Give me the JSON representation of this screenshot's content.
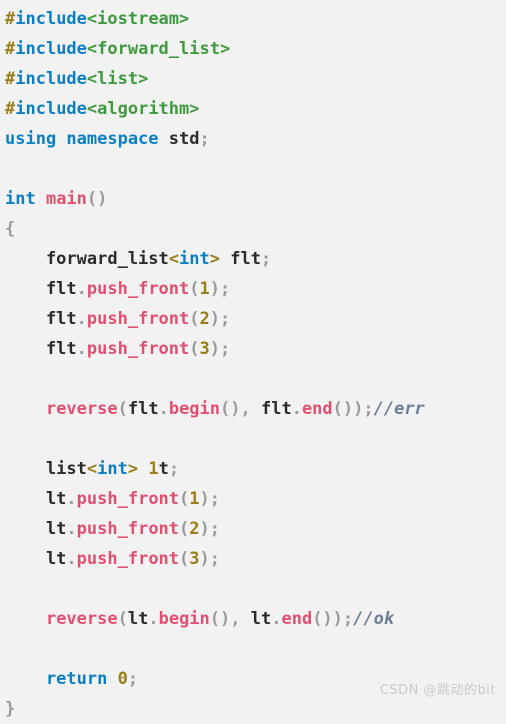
{
  "editor": {
    "language": "C++",
    "background_color": "#f2f2f2",
    "theme_colors": {
      "plain": "#2b2b2b",
      "keyword": "#0c7fc4",
      "preprocessor": "#9a7d16",
      "include_path": "#3f9a3f",
      "function": "#e05071",
      "number": "#9a7d16",
      "punctuation": "#9a9a9a",
      "comment": "#6b7f99",
      "watermark": "#c9c9c9"
    },
    "lines": [
      {
        "id": "line-1",
        "tokens": [
          {
            "t": "pre",
            "v": "#"
          },
          {
            "t": "kw",
            "v": "include"
          },
          {
            "t": "inc",
            "v": "<iostream>"
          }
        ]
      },
      {
        "id": "line-2",
        "tokens": [
          {
            "t": "pre",
            "v": "#"
          },
          {
            "t": "kw",
            "v": "include"
          },
          {
            "t": "inc",
            "v": "<forward_list>"
          }
        ]
      },
      {
        "id": "line-3",
        "tokens": [
          {
            "t": "pre",
            "v": "#"
          },
          {
            "t": "kw",
            "v": "include"
          },
          {
            "t": "inc",
            "v": "<list>"
          }
        ]
      },
      {
        "id": "line-4",
        "tokens": [
          {
            "t": "pre",
            "v": "#"
          },
          {
            "t": "kw",
            "v": "include"
          },
          {
            "t": "inc",
            "v": "<algorithm>"
          }
        ]
      },
      {
        "id": "line-5",
        "tokens": [
          {
            "t": "kw",
            "v": "using namespace "
          },
          {
            "t": "plain",
            "v": "std"
          },
          {
            "t": "punc",
            "v": ";"
          }
        ]
      },
      {
        "id": "line-6",
        "tokens": []
      },
      {
        "id": "line-7",
        "tokens": [
          {
            "t": "kw",
            "v": "int "
          },
          {
            "t": "fn",
            "v": "main"
          },
          {
            "t": "punc",
            "v": "()"
          }
        ]
      },
      {
        "id": "line-8",
        "tokens": [
          {
            "t": "punc",
            "v": "{"
          }
        ]
      },
      {
        "id": "line-9",
        "tokens": [
          {
            "t": "plain",
            "v": "    forward_list"
          },
          {
            "t": "angle",
            "v": "<"
          },
          {
            "t": "kw",
            "v": "int"
          },
          {
            "t": "angle",
            "v": "> "
          },
          {
            "t": "plain",
            "v": "flt"
          },
          {
            "t": "punc",
            "v": ";"
          }
        ]
      },
      {
        "id": "line-10",
        "tokens": [
          {
            "t": "plain",
            "v": "    flt"
          },
          {
            "t": "punc",
            "v": "."
          },
          {
            "t": "fn",
            "v": "push_front"
          },
          {
            "t": "punc",
            "v": "("
          },
          {
            "t": "num",
            "v": "1"
          },
          {
            "t": "punc",
            "v": ");"
          }
        ]
      },
      {
        "id": "line-11",
        "tokens": [
          {
            "t": "plain",
            "v": "    flt"
          },
          {
            "t": "punc",
            "v": "."
          },
          {
            "t": "fn",
            "v": "push_front"
          },
          {
            "t": "punc",
            "v": "("
          },
          {
            "t": "num",
            "v": "2"
          },
          {
            "t": "punc",
            "v": ");"
          }
        ]
      },
      {
        "id": "line-12",
        "tokens": [
          {
            "t": "plain",
            "v": "    flt"
          },
          {
            "t": "punc",
            "v": "."
          },
          {
            "t": "fn",
            "v": "push_front"
          },
          {
            "t": "punc",
            "v": "("
          },
          {
            "t": "num",
            "v": "3"
          },
          {
            "t": "punc",
            "v": ");"
          }
        ]
      },
      {
        "id": "line-13",
        "tokens": []
      },
      {
        "id": "line-14",
        "tokens": [
          {
            "t": "plain",
            "v": "    "
          },
          {
            "t": "fn",
            "v": "reverse"
          },
          {
            "t": "punc",
            "v": "("
          },
          {
            "t": "plain",
            "v": "flt"
          },
          {
            "t": "punc",
            "v": "."
          },
          {
            "t": "fn",
            "v": "begin"
          },
          {
            "t": "punc",
            "v": "(), "
          },
          {
            "t": "plain",
            "v": "flt"
          },
          {
            "t": "punc",
            "v": "."
          },
          {
            "t": "fn",
            "v": "end"
          },
          {
            "t": "punc",
            "v": "());"
          },
          {
            "t": "cmt",
            "v": "//err"
          }
        ]
      },
      {
        "id": "line-15",
        "tokens": []
      },
      {
        "id": "line-16",
        "tokens": [
          {
            "t": "plain",
            "v": "    list"
          },
          {
            "t": "angle",
            "v": "<"
          },
          {
            "t": "kw",
            "v": "int"
          },
          {
            "t": "angle",
            "v": "> "
          },
          {
            "t": "num",
            "v": "1"
          },
          {
            "t": "plain",
            "v": "t"
          },
          {
            "t": "punc",
            "v": ";"
          }
        ]
      },
      {
        "id": "line-17",
        "tokens": [
          {
            "t": "plain",
            "v": "    lt"
          },
          {
            "t": "punc",
            "v": "."
          },
          {
            "t": "fn",
            "v": "push_front"
          },
          {
            "t": "punc",
            "v": "("
          },
          {
            "t": "num",
            "v": "1"
          },
          {
            "t": "punc",
            "v": ");"
          }
        ]
      },
      {
        "id": "line-18",
        "tokens": [
          {
            "t": "plain",
            "v": "    lt"
          },
          {
            "t": "punc",
            "v": "."
          },
          {
            "t": "fn",
            "v": "push_front"
          },
          {
            "t": "punc",
            "v": "("
          },
          {
            "t": "num",
            "v": "2"
          },
          {
            "t": "punc",
            "v": ");"
          }
        ]
      },
      {
        "id": "line-19",
        "tokens": [
          {
            "t": "plain",
            "v": "    lt"
          },
          {
            "t": "punc",
            "v": "."
          },
          {
            "t": "fn",
            "v": "push_front"
          },
          {
            "t": "punc",
            "v": "("
          },
          {
            "t": "num",
            "v": "3"
          },
          {
            "t": "punc",
            "v": ");"
          }
        ]
      },
      {
        "id": "line-20",
        "tokens": []
      },
      {
        "id": "line-21",
        "tokens": [
          {
            "t": "plain",
            "v": "    "
          },
          {
            "t": "fn",
            "v": "reverse"
          },
          {
            "t": "punc",
            "v": "("
          },
          {
            "t": "plain",
            "v": "lt"
          },
          {
            "t": "punc",
            "v": "."
          },
          {
            "t": "fn",
            "v": "begin"
          },
          {
            "t": "punc",
            "v": "(), "
          },
          {
            "t": "plain",
            "v": "lt"
          },
          {
            "t": "punc",
            "v": "."
          },
          {
            "t": "fn",
            "v": "end"
          },
          {
            "t": "punc",
            "v": "());"
          },
          {
            "t": "cmt",
            "v": "//ok"
          }
        ]
      },
      {
        "id": "line-22",
        "tokens": []
      },
      {
        "id": "line-23",
        "tokens": [
          {
            "t": "kw",
            "v": "    return "
          },
          {
            "t": "num",
            "v": "0"
          },
          {
            "t": "punc",
            "v": ";"
          }
        ]
      },
      {
        "id": "line-24",
        "tokens": [
          {
            "t": "punc",
            "v": "}"
          }
        ]
      }
    ]
  },
  "watermark": {
    "text": "CSDN @跳动的bit"
  }
}
